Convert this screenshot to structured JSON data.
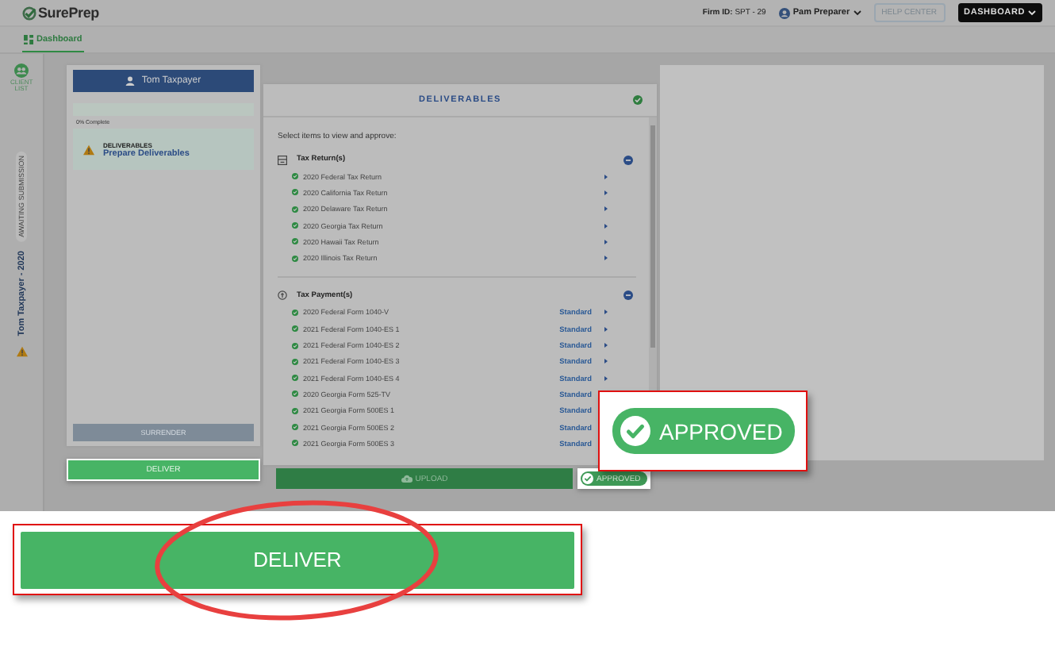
{
  "header": {
    "logo": "SurePrep",
    "firm_id_label": "Firm ID:",
    "firm_id": "SPT - 29",
    "user": "Pam Preparer",
    "help_button": "HELP CENTER",
    "dashboard_button": "DASHBOARD"
  },
  "nav": {
    "tabs": [
      {
        "label": "Dashboard",
        "selected": true
      }
    ]
  },
  "rail": {
    "client_list": "CLIENT LIST",
    "status_pill": "AWAITING SUBMISSION",
    "client_title": "Tom Taxpayer - 2020"
  },
  "client_panel": {
    "name": "Tom Taxpayer",
    "progress": {
      "label": "0% Complete",
      "level": 0
    },
    "task": {
      "title": "DELIVERABLES",
      "link": "Prepare Deliverables"
    },
    "surrender_button": {
      "label": "SURRENDER",
      "disabled": true
    },
    "deliver_button": "DELIVER"
  },
  "deliverables": {
    "title": "DELIVERABLES",
    "instruction": "Select items to view and approve:",
    "groups": [
      {
        "title": "Tax Return(s)",
        "kind": "return",
        "expanded": true,
        "items": [
          {
            "label": "2020 Federal Tax Return"
          },
          {
            "label": "2020 California Tax Return"
          },
          {
            "label": "2020 Delaware Tax Return"
          },
          {
            "label": "2020 Georgia Tax Return"
          },
          {
            "label": "2020 Hawaii Tax Return"
          },
          {
            "label": "2020 Illinois Tax Return"
          }
        ]
      },
      {
        "title": "Tax Payment(s)",
        "kind": "payment",
        "expanded": true,
        "items": [
          {
            "label": "2020 Federal Form 1040-V",
            "method": "Standard"
          },
          {
            "label": "2021 Federal Form 1040-ES 1",
            "method": "Standard"
          },
          {
            "label": "2021 Federal Form 1040-ES 2",
            "method": "Standard"
          },
          {
            "label": "2021 Federal Form 1040-ES 3",
            "method": "Standard"
          },
          {
            "label": "2021 Federal Form 1040-ES 4",
            "method": "Standard"
          },
          {
            "label": "2020 Georgia Form 525-TV",
            "method": "Standard"
          },
          {
            "label": "2021 Georgia Form 500ES 1",
            "method": "Standard"
          },
          {
            "label": "2021 Georgia Form 500ES 2",
            "method": "Standard"
          },
          {
            "label": "2021 Georgia Form 500ES 3",
            "method": "Standard"
          }
        ]
      }
    ],
    "upload_button": "UPLOAD",
    "status": "APPROVED"
  },
  "callouts": [
    {
      "kind": "approved",
      "label": "APPROVED"
    },
    {
      "kind": "deliver",
      "label": "DELIVER"
    }
  ]
}
